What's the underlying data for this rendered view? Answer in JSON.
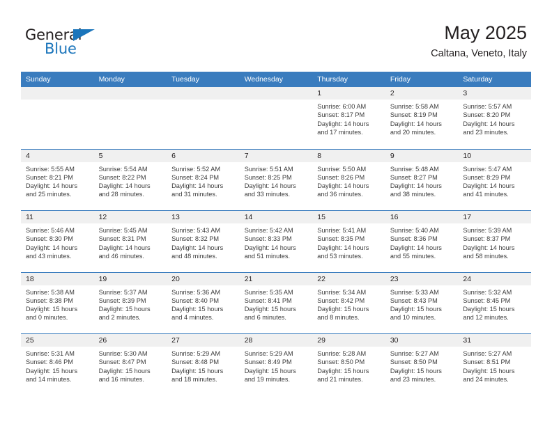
{
  "brand": {
    "name_part1": "General",
    "name_part2": "Blue",
    "accent_color": "#1b75bb"
  },
  "header": {
    "title": "May 2025",
    "subtitle": "Caltana, Veneto, Italy"
  },
  "theme": {
    "header_bg": "#3a7cbe",
    "dateband_bg": "#f0f0f0",
    "text_color": "#231f20"
  },
  "weekdays": [
    "Sunday",
    "Monday",
    "Tuesday",
    "Wednesday",
    "Thursday",
    "Friday",
    "Saturday"
  ],
  "weeks": [
    [
      {
        "date": "",
        "sunrise": "",
        "sunset": "",
        "daylight": ""
      },
      {
        "date": "",
        "sunrise": "",
        "sunset": "",
        "daylight": ""
      },
      {
        "date": "",
        "sunrise": "",
        "sunset": "",
        "daylight": ""
      },
      {
        "date": "",
        "sunrise": "",
        "sunset": "",
        "daylight": ""
      },
      {
        "date": "1",
        "sunrise": "Sunrise: 6:00 AM",
        "sunset": "Sunset: 8:17 PM",
        "daylight": "Daylight: 14 hours and 17 minutes."
      },
      {
        "date": "2",
        "sunrise": "Sunrise: 5:58 AM",
        "sunset": "Sunset: 8:19 PM",
        "daylight": "Daylight: 14 hours and 20 minutes."
      },
      {
        "date": "3",
        "sunrise": "Sunrise: 5:57 AM",
        "sunset": "Sunset: 8:20 PM",
        "daylight": "Daylight: 14 hours and 23 minutes."
      }
    ],
    [
      {
        "date": "4",
        "sunrise": "Sunrise: 5:55 AM",
        "sunset": "Sunset: 8:21 PM",
        "daylight": "Daylight: 14 hours and 25 minutes."
      },
      {
        "date": "5",
        "sunrise": "Sunrise: 5:54 AM",
        "sunset": "Sunset: 8:22 PM",
        "daylight": "Daylight: 14 hours and 28 minutes."
      },
      {
        "date": "6",
        "sunrise": "Sunrise: 5:52 AM",
        "sunset": "Sunset: 8:24 PM",
        "daylight": "Daylight: 14 hours and 31 minutes."
      },
      {
        "date": "7",
        "sunrise": "Sunrise: 5:51 AM",
        "sunset": "Sunset: 8:25 PM",
        "daylight": "Daylight: 14 hours and 33 minutes."
      },
      {
        "date": "8",
        "sunrise": "Sunrise: 5:50 AM",
        "sunset": "Sunset: 8:26 PM",
        "daylight": "Daylight: 14 hours and 36 minutes."
      },
      {
        "date": "9",
        "sunrise": "Sunrise: 5:48 AM",
        "sunset": "Sunset: 8:27 PM",
        "daylight": "Daylight: 14 hours and 38 minutes."
      },
      {
        "date": "10",
        "sunrise": "Sunrise: 5:47 AM",
        "sunset": "Sunset: 8:29 PM",
        "daylight": "Daylight: 14 hours and 41 minutes."
      }
    ],
    [
      {
        "date": "11",
        "sunrise": "Sunrise: 5:46 AM",
        "sunset": "Sunset: 8:30 PM",
        "daylight": "Daylight: 14 hours and 43 minutes."
      },
      {
        "date": "12",
        "sunrise": "Sunrise: 5:45 AM",
        "sunset": "Sunset: 8:31 PM",
        "daylight": "Daylight: 14 hours and 46 minutes."
      },
      {
        "date": "13",
        "sunrise": "Sunrise: 5:43 AM",
        "sunset": "Sunset: 8:32 PM",
        "daylight": "Daylight: 14 hours and 48 minutes."
      },
      {
        "date": "14",
        "sunrise": "Sunrise: 5:42 AM",
        "sunset": "Sunset: 8:33 PM",
        "daylight": "Daylight: 14 hours and 51 minutes."
      },
      {
        "date": "15",
        "sunrise": "Sunrise: 5:41 AM",
        "sunset": "Sunset: 8:35 PM",
        "daylight": "Daylight: 14 hours and 53 minutes."
      },
      {
        "date": "16",
        "sunrise": "Sunrise: 5:40 AM",
        "sunset": "Sunset: 8:36 PM",
        "daylight": "Daylight: 14 hours and 55 minutes."
      },
      {
        "date": "17",
        "sunrise": "Sunrise: 5:39 AM",
        "sunset": "Sunset: 8:37 PM",
        "daylight": "Daylight: 14 hours and 58 minutes."
      }
    ],
    [
      {
        "date": "18",
        "sunrise": "Sunrise: 5:38 AM",
        "sunset": "Sunset: 8:38 PM",
        "daylight": "Daylight: 15 hours and 0 minutes."
      },
      {
        "date": "19",
        "sunrise": "Sunrise: 5:37 AM",
        "sunset": "Sunset: 8:39 PM",
        "daylight": "Daylight: 15 hours and 2 minutes."
      },
      {
        "date": "20",
        "sunrise": "Sunrise: 5:36 AM",
        "sunset": "Sunset: 8:40 PM",
        "daylight": "Daylight: 15 hours and 4 minutes."
      },
      {
        "date": "21",
        "sunrise": "Sunrise: 5:35 AM",
        "sunset": "Sunset: 8:41 PM",
        "daylight": "Daylight: 15 hours and 6 minutes."
      },
      {
        "date": "22",
        "sunrise": "Sunrise: 5:34 AM",
        "sunset": "Sunset: 8:42 PM",
        "daylight": "Daylight: 15 hours and 8 minutes."
      },
      {
        "date": "23",
        "sunrise": "Sunrise: 5:33 AM",
        "sunset": "Sunset: 8:43 PM",
        "daylight": "Daylight: 15 hours and 10 minutes."
      },
      {
        "date": "24",
        "sunrise": "Sunrise: 5:32 AM",
        "sunset": "Sunset: 8:45 PM",
        "daylight": "Daylight: 15 hours and 12 minutes."
      }
    ],
    [
      {
        "date": "25",
        "sunrise": "Sunrise: 5:31 AM",
        "sunset": "Sunset: 8:46 PM",
        "daylight": "Daylight: 15 hours and 14 minutes."
      },
      {
        "date": "26",
        "sunrise": "Sunrise: 5:30 AM",
        "sunset": "Sunset: 8:47 PM",
        "daylight": "Daylight: 15 hours and 16 minutes."
      },
      {
        "date": "27",
        "sunrise": "Sunrise: 5:29 AM",
        "sunset": "Sunset: 8:48 PM",
        "daylight": "Daylight: 15 hours and 18 minutes."
      },
      {
        "date": "28",
        "sunrise": "Sunrise: 5:29 AM",
        "sunset": "Sunset: 8:49 PM",
        "daylight": "Daylight: 15 hours and 19 minutes."
      },
      {
        "date": "29",
        "sunrise": "Sunrise: 5:28 AM",
        "sunset": "Sunset: 8:50 PM",
        "daylight": "Daylight: 15 hours and 21 minutes."
      },
      {
        "date": "30",
        "sunrise": "Sunrise: 5:27 AM",
        "sunset": "Sunset: 8:50 PM",
        "daylight": "Daylight: 15 hours and 23 minutes."
      },
      {
        "date": "31",
        "sunrise": "Sunrise: 5:27 AM",
        "sunset": "Sunset: 8:51 PM",
        "daylight": "Daylight: 15 hours and 24 minutes."
      }
    ]
  ]
}
